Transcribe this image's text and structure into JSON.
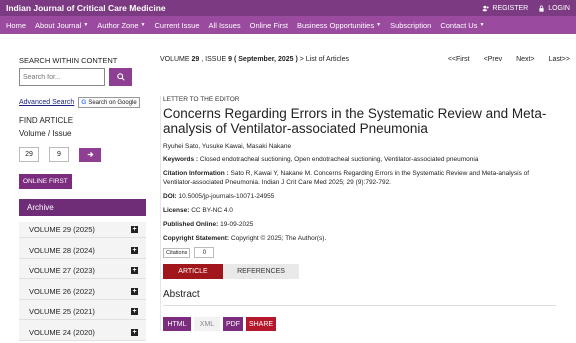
{
  "topbar": {
    "brand": "Indian Journal of Critical Care Medicine",
    "register": "REGISTER",
    "login": "LOGIN"
  },
  "nav": [
    {
      "label": "Home",
      "caret": false
    },
    {
      "label": "About Journal",
      "caret": true
    },
    {
      "label": "Author Zone",
      "caret": true
    },
    {
      "label": "Current Issue",
      "caret": false
    },
    {
      "label": "All Issues",
      "caret": false
    },
    {
      "label": "Online First",
      "caret": false
    },
    {
      "label": "Business Opportunities",
      "caret": true
    },
    {
      "label": "Subscription",
      "caret": false
    },
    {
      "label": "Contact Us",
      "caret": true
    }
  ],
  "sidebar": {
    "search_title": "SEARCH WITHIN CONTENT",
    "search_placeholder": "Search for...",
    "advanced_search": "Advanced Search",
    "google_search": "Search on Google",
    "find_article": "FIND ARTICLE",
    "volume_issue": "Volume / Issue",
    "volume_value": "29",
    "issue_value": "9",
    "online_first": "ONLINE FIRST",
    "archive_title": "Archive",
    "archive_items": [
      "VOLUME  29 (2025)",
      "VOLUME  28 (2024)",
      "VOLUME  27 (2023)",
      "VOLUME  26 (2022)",
      "VOLUME  25 (2021)",
      "VOLUME  24 (2020)"
    ]
  },
  "main": {
    "breadcrumb_prefix": "VOLUME",
    "volume": "29",
    "issue_label": ", ISSUE",
    "issue": "9",
    "date": "( September, 2025 )",
    "list_link": "> List of Articles",
    "first": "<<First",
    "prev": "<Prev",
    "next": "Next>",
    "last": "Last>>"
  },
  "article": {
    "category": "LETTER TO THE EDITOR",
    "title": "Concerns Regarding Errors in the Systematic Review and Meta-analysis of Ventilator-associated Pneumonia",
    "authors": "Ryuhei Sato, Yusuke Kawai, Masaki Nakane",
    "keywords_label": "Keywords :",
    "keywords": "Closed endotracheal suctioning, Open endotracheal suctioning, Ventilator-associated pneumonia",
    "citation_label": "Citation Information :",
    "citation": "Sato R, Kawai Y, Nakane M. Concerns Regarding Errors in the Systematic Review and Meta-analysis of Ventilator-associated Pneumonia. Indian J Crit Care Med 2025; 29 (9):792-792.",
    "doi_label": "DOI:",
    "doi": "10.5005/jp-journals-10071-24955",
    "license_label": "License:",
    "license": "CC BY-NC 4.0",
    "published_label": "Published Online:",
    "published": "19-09-2025",
    "copyright_label": "Copyright Statement:",
    "copyright": "Copyright © 2025; The Author(s).",
    "citations_badge": "Citations",
    "citations_count": "0",
    "tab_article": "ARTICLE",
    "tab_references": "REFERENCES",
    "abstract_title": "Abstract",
    "formats": [
      "HTML",
      "XML",
      "PDF",
      "SHARE"
    ]
  },
  "colors": {
    "topbar": "#7b3a82",
    "navbar": "#9a4b9f",
    "accent": "#8e3f93",
    "tab_active": "#a0161b"
  }
}
